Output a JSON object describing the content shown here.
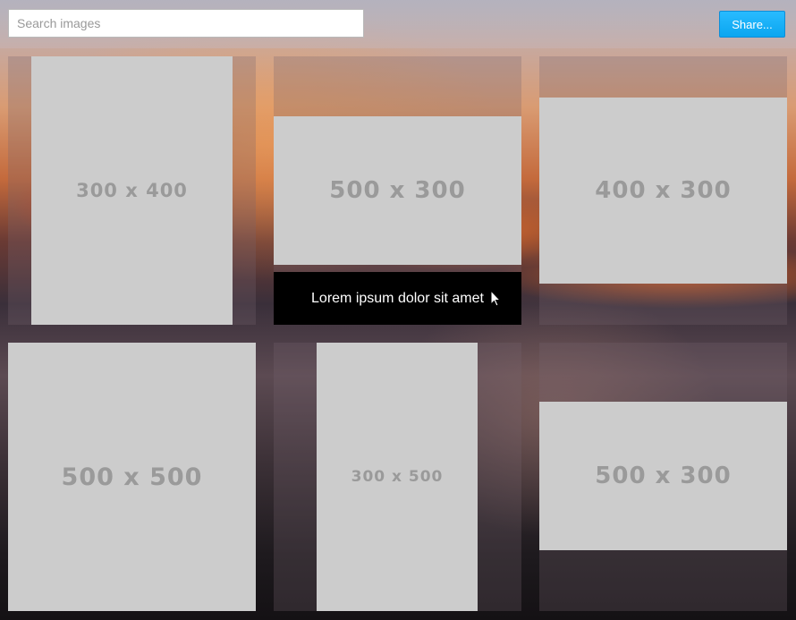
{
  "search": {
    "placeholder": "Search images"
  },
  "toolbar": {
    "share_label": "Share..."
  },
  "gallery": {
    "tiles": [
      {
        "label": "300 x 400"
      },
      {
        "label": "500 x 300",
        "caption": "Lorem ipsum dolor sit amet"
      },
      {
        "label": "400 x 300"
      },
      {
        "label": "500 x 500"
      },
      {
        "label": "300 x 500"
      },
      {
        "label": "500 x 300"
      }
    ]
  },
  "colors": {
    "placeholder_bg": "#cccccc",
    "placeholder_text": "#9a9a9a",
    "accent": "#1aaef5",
    "caption_bg": "#000000"
  },
  "icons": {
    "cursor": "mouse-pointer-icon"
  }
}
